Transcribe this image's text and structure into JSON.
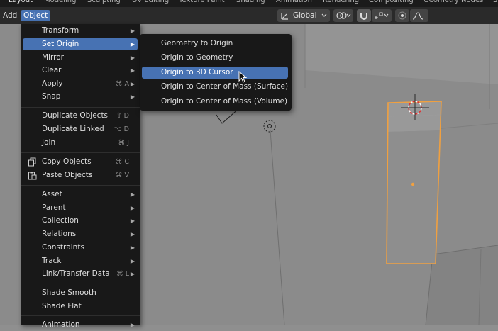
{
  "workspace_tabs": [
    {
      "label": "Layout",
      "active": true
    },
    {
      "label": "Modeling",
      "active": false
    },
    {
      "label": "Sculpting",
      "active": false
    },
    {
      "label": "UV Editing",
      "active": false
    },
    {
      "label": "Texture Paint",
      "active": false
    },
    {
      "label": "Shading",
      "active": false
    },
    {
      "label": "Animation",
      "active": false
    },
    {
      "label": "Rendering",
      "active": false
    },
    {
      "label": "Compositing",
      "active": false
    },
    {
      "label": "Geometry Nodes",
      "active": false
    },
    {
      "label": "S",
      "active": false
    }
  ],
  "header": {
    "menus": [
      "Add",
      "Object"
    ],
    "active_menu": "Object",
    "transform_orientation": "Global",
    "icons": [
      "transform-orientation-icon",
      "chevron-down-icon",
      "pivot-point-icon",
      "snap-magnet-icon",
      "snap-target-icon",
      "proportional-edit-icon",
      "falloff-curve-icon"
    ]
  },
  "object_menu": {
    "groups": [
      [
        {
          "label": "Transform",
          "submenu": true
        },
        {
          "label": "Set Origin",
          "submenu": true,
          "highlighted": true
        },
        {
          "label": "Mirror",
          "submenu": true
        },
        {
          "label": "Clear",
          "submenu": true
        },
        {
          "label": "Apply",
          "shortcut": "⌘ A",
          "submenu": true
        },
        {
          "label": "Snap",
          "submenu": true
        }
      ],
      [
        {
          "label": "Duplicate Objects",
          "shortcut": "⇧ D"
        },
        {
          "label": "Duplicate Linked",
          "shortcut": "⌥ D"
        },
        {
          "label": "Join",
          "shortcut": "⌘ J"
        }
      ],
      [
        {
          "label": "Copy Objects",
          "shortcut": "⌘ C",
          "icon": "copy-icon"
        },
        {
          "label": "Paste Objects",
          "shortcut": "⌘ V",
          "icon": "paste-icon"
        }
      ],
      [
        {
          "label": "Asset",
          "submenu": true
        },
        {
          "label": "Parent",
          "submenu": true
        },
        {
          "label": "Collection",
          "submenu": true
        },
        {
          "label": "Relations",
          "submenu": true
        },
        {
          "label": "Constraints",
          "submenu": true
        },
        {
          "label": "Track",
          "submenu": true
        },
        {
          "label": "Link/Transfer Data",
          "shortcut": "⌘ L",
          "submenu": true
        }
      ],
      [
        {
          "label": "Shade Smooth"
        },
        {
          "label": "Shade Flat"
        }
      ],
      [
        {
          "label": "Animation",
          "submenu": true
        }
      ]
    ]
  },
  "set_origin_submenu": {
    "items": [
      {
        "label": "Geometry to Origin"
      },
      {
        "label": "Origin to Geometry"
      },
      {
        "label": "Origin to 3D Cursor",
        "highlighted": true
      },
      {
        "label": "Origin to Center of Mass (Surface)"
      },
      {
        "label": "Origin to Center of Mass (Volume)"
      }
    ]
  },
  "colors": {
    "accent": "#4772b3",
    "menu_bg": "#181818",
    "selection_outline": "#f0a040",
    "viewport_bg": "#8b8b8b"
  }
}
